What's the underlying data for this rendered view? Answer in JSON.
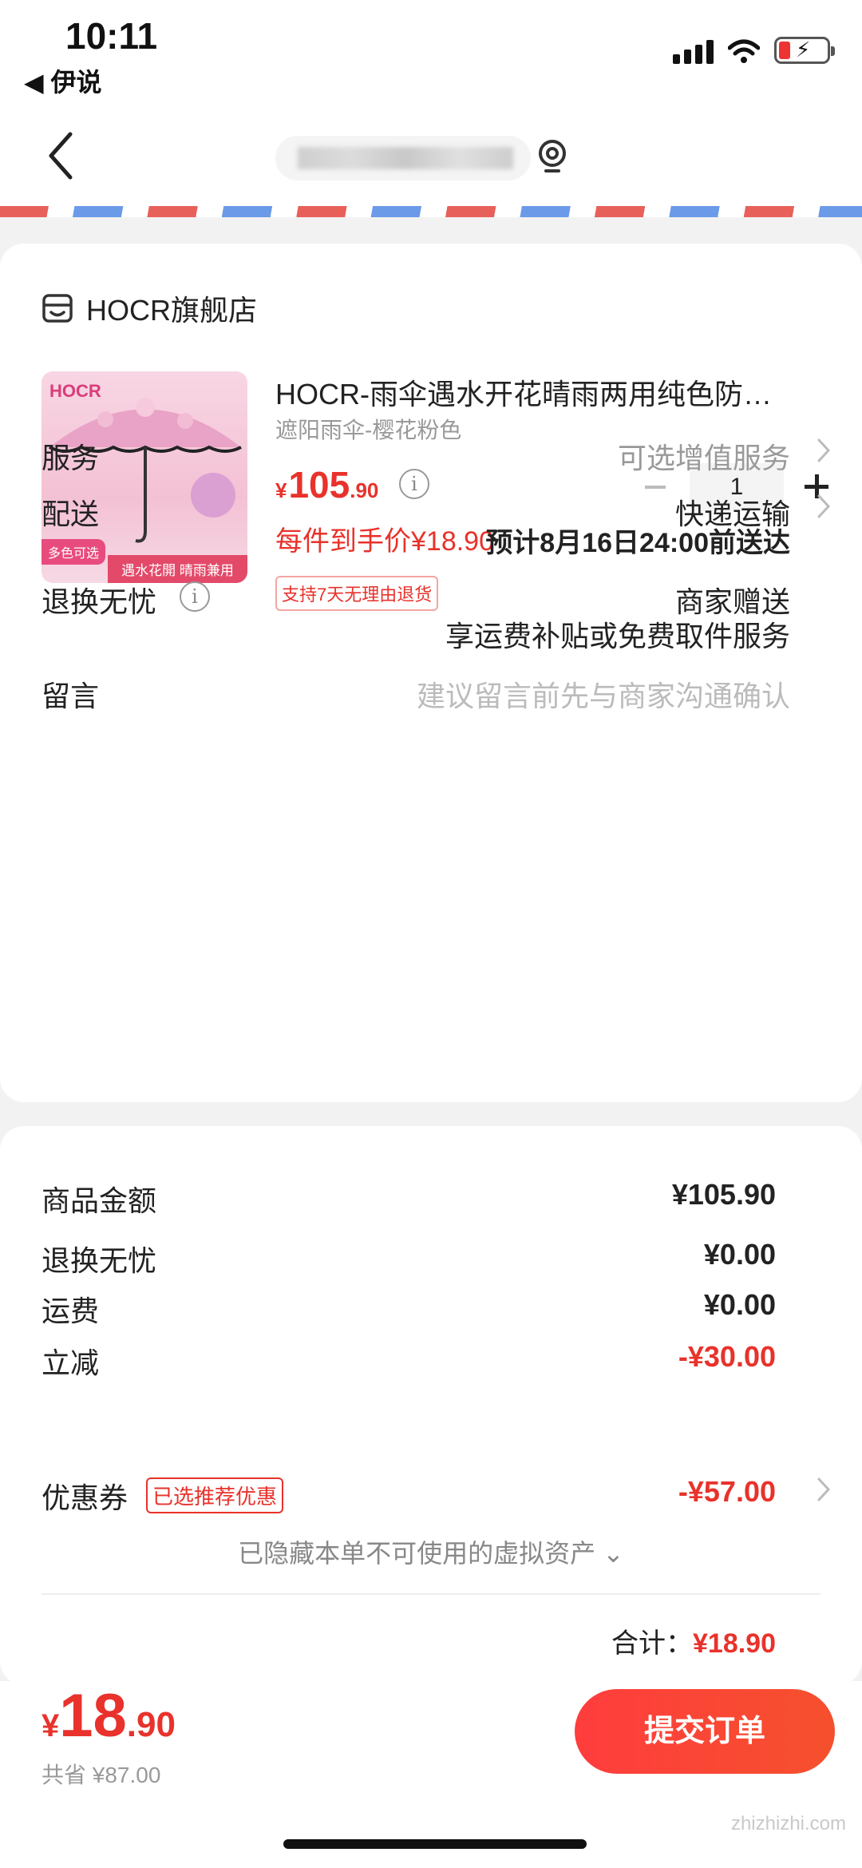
{
  "status_bar": {
    "time": "10:11",
    "back_app": "◀ 伊说"
  },
  "shop": {
    "name": "HOCR旗舰店"
  },
  "product": {
    "title": "HOCR-雨伞遇水开花晴雨两用纯色防…",
    "variant": "遮阳雨伞-樱花粉色",
    "price_currency": "¥",
    "price_int": "105",
    "price_dec": ".90",
    "unit_price": "每件到手价¥18.90",
    "refund_tag": "支持7天无理由退货",
    "quantity": "1",
    "thumb": {
      "brand": "HOCR",
      "tag_colors": "多色可选",
      "tag_feature": "遇水花開 晴雨兼用"
    }
  },
  "rows": {
    "service_label": "服务",
    "service_value": "可选增值服务",
    "delivery_label": "配送",
    "delivery_value": "快递运输",
    "delivery_eta": "预计8月16日24:00前送达",
    "return_label": "退换无忧",
    "return_value": "商家赠送",
    "return_desc": "享运费补贴或免费取件服务",
    "message_label": "留言",
    "message_placeholder": "建议留言前先与商家沟通确认"
  },
  "summary": {
    "goods_label": "商品金额",
    "goods_value": "¥105.90",
    "return_label": "退换无忧",
    "return_value": "¥0.00",
    "shipping_label": "运费",
    "shipping_value": "¥0.00",
    "discount_label": "立减",
    "discount_value": "-¥30.00",
    "coupon_label": "优惠券",
    "coupon_tag": "已选推荐优惠",
    "coupon_value": "-¥57.00",
    "hidden_assets": "已隐藏本单不可使用的虚拟资产 ⌄",
    "total_label": "合计：",
    "total_value": "¥18.90"
  },
  "bottom": {
    "currency": "¥",
    "price_int": "18",
    "price_dec": ".90",
    "saved": "共省 ¥87.00",
    "submit_label": "提交订单"
  },
  "watermark": "zhizhizhi.com",
  "colors": {
    "accent": "#e8322b",
    "button_start": "#ff3d3d",
    "button_end": "#f5502d"
  }
}
